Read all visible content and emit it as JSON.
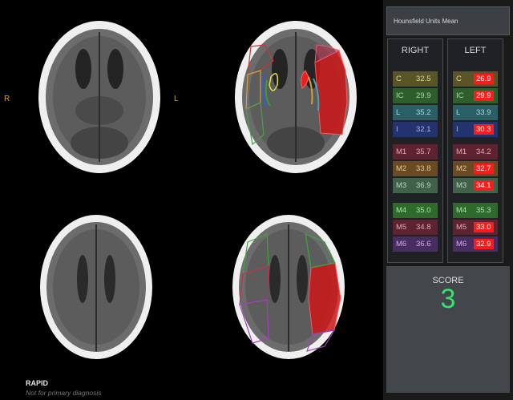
{
  "orientation": {
    "right": "R",
    "left": "L"
  },
  "footer": {
    "brand": "RAPID",
    "note": "Not for primary diagnosis"
  },
  "panel": {
    "title": "Hounsfield Units Mean",
    "right_header": "RIGHT",
    "left_header": "LEFT",
    "regions": [
      {
        "label": "C",
        "right": "32.5",
        "left": "26.9",
        "left_flag": true,
        "bg": "#5a5529",
        "fg": "#dcd7a0"
      },
      {
        "label": "IC",
        "right": "29.9",
        "left": "29.9",
        "left_flag": true,
        "bg": "#2e5e2b",
        "fg": "#a9dba6"
      },
      {
        "label": "L",
        "right": "35.2",
        "left": "33.9",
        "left_flag": false,
        "bg": "#2b5f66",
        "fg": "#a9d9df"
      },
      {
        "label": "I",
        "right": "32.1",
        "left": "30.3",
        "left_flag": true,
        "bg": "#23336d",
        "fg": "#a8b5e0"
      },
      {
        "label": "M1",
        "right": "35.7",
        "left": "34.2",
        "left_flag": false,
        "bg": "#5e2330",
        "fg": "#e0a8b3"
      },
      {
        "label": "M2",
        "right": "33.8",
        "left": "32.7",
        "left_flag": true,
        "bg": "#6a4a22",
        "fg": "#e3c59c"
      },
      {
        "label": "M3",
        "right": "36.9",
        "left": "34.1",
        "left_flag": true,
        "bg": "#42614a",
        "fg": "#b4d6bc"
      },
      {
        "label": "M4",
        "right": "35.0",
        "left": "35.3",
        "left_flag": false,
        "bg": "#2f6a2d",
        "fg": "#aee0ac"
      },
      {
        "label": "M5",
        "right": "34.8",
        "left": "33.0",
        "left_flag": true,
        "bg": "#5c2430",
        "fg": "#e1a7b3"
      },
      {
        "label": "M6",
        "right": "36.6",
        "left": "32.9",
        "left_flag": true,
        "bg": "#4a2c64",
        "fg": "#cbb1e3"
      }
    ],
    "score_label": "SCORE",
    "score_value": "3"
  }
}
